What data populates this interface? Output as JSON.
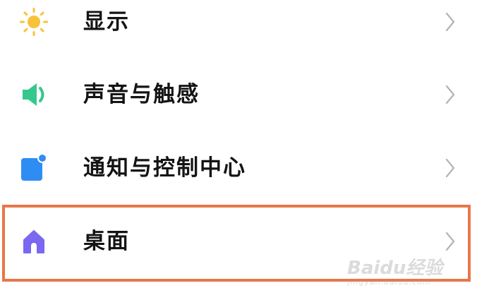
{
  "settings": {
    "items": [
      {
        "label": "显示",
        "icon": "sun-icon",
        "icon_color": "#f8c33a"
      },
      {
        "label": "声音与触感",
        "icon": "speaker-icon",
        "icon_color": "#35c88e"
      },
      {
        "label": "通知与控制中心",
        "icon": "notification-icon",
        "icon_color": "#2f8cf2"
      },
      {
        "label": "桌面",
        "icon": "home-icon",
        "icon_color": "#7a68f0"
      }
    ],
    "highlighted_item": "桌面"
  },
  "colors": {
    "highlight_border": "#e8774a",
    "chevron": "#b3b3b3",
    "text": "#141414",
    "background": "#ffffff"
  },
  "watermark": {
    "text": "Baidu经验",
    "subtext": "jingyan.baidu.com"
  }
}
